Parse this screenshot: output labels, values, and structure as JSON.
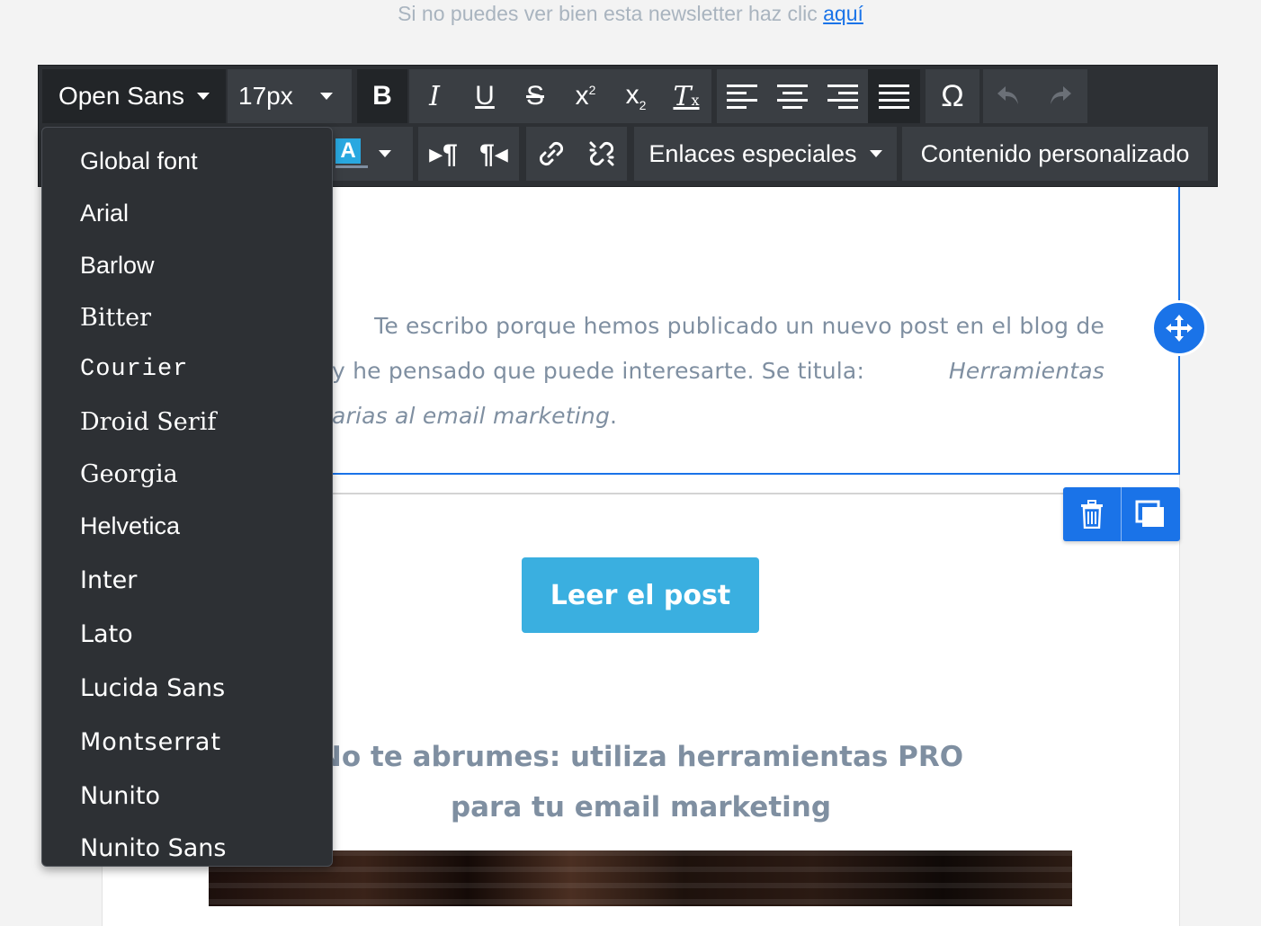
{
  "top_note": {
    "text": "Si no puedes ver bien esta newsletter haz clic ",
    "link": "aquí"
  },
  "toolbar": {
    "font_family": "Open Sans",
    "font_size": "17px",
    "color_letter": "A",
    "special_links": "Enlaces especiales",
    "custom_content": "Contenido personalizado"
  },
  "font_menu": {
    "items": [
      "Global font",
      "Arial",
      "Barlow",
      "Bitter",
      "Courier",
      "Droid Serif",
      "Georgia",
      "Helvetica",
      "Inter",
      "Lato",
      "Lucida Sans",
      "Montserrat",
      "Nunito",
      "Nunito Sans"
    ]
  },
  "content": {
    "para_line1": "Te escribo porque hemos publicado un nuevo post en el blog de",
    "para_line2_start": "y he pensado que puede interesarte. Se titula: ",
    "para_line2_em": "Herramientas",
    "para_line3_em": "arias al email marketing",
    "para_line3_end": ".",
    "cta": "Leer el post",
    "subhead_line1": "No te abrumes: utiliza herramientas PRO",
    "subhead_line2": "para tu email marketing"
  },
  "colors": {
    "accent": "#1a73e8",
    "toolbar_bg": "#2d3034",
    "cta_bg": "#3aafe0",
    "text": "#7f8fa1"
  }
}
